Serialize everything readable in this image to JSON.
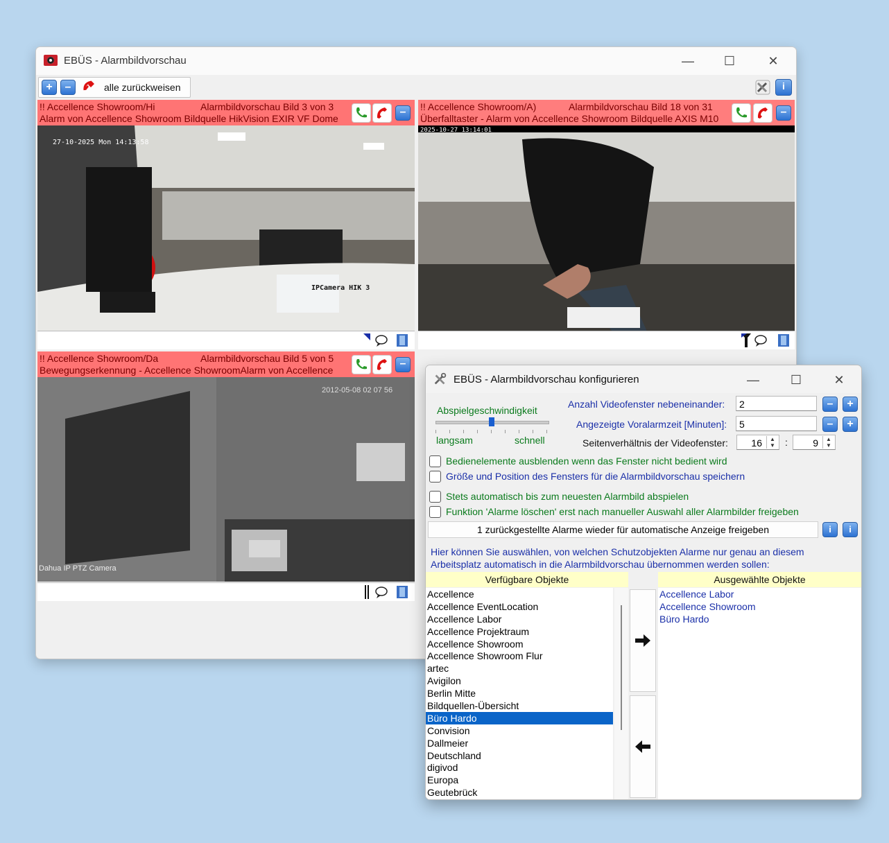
{
  "main_window": {
    "title": "EBÜS - Alarmbildvorschau",
    "toolbar": {
      "reject_all_label": "alle zurückweisen"
    },
    "panes": [
      {
        "line1_left": "!! Accellence Showroom/Hi",
        "line1_right": "Alarmbildvorschau Bild 3 von 3",
        "line2": "Alarm von Accellence Showroom Bildquelle HikVision EXIR VF Dome",
        "overlay_time": "27-10-2025 Mon 14:13:58",
        "overlay_cam": "IPCamera HIK 3"
      },
      {
        "line1_left": "!! Accellence Showroom/A)",
        "line1_right": "Alarmbildvorschau Bild 18 von 31",
        "line2": "Überfalltaster - Alarm von Accellence Showroom Bildquelle AXIS M10",
        "overlay_time": "2025-10-27  13:14:01"
      },
      {
        "line1_left": "!! Accellence Showroom/Da",
        "line1_right": "Alarmbildvorschau Bild 5 von 5",
        "line2": "Bewegungserkennung - Accellence ShowroomAlarm von Accellence",
        "overlay_time": "2012-05-08 02 07 56",
        "overlay_cam": "Dahua IP PTZ Camera"
      }
    ]
  },
  "config_dialog": {
    "title": "EBÜS - Alarmbildvorschau konfigurieren",
    "speed": {
      "label": "Abspielgeschwindigkeit",
      "slow": "langsam",
      "fast": "schnell",
      "value_fraction": 0.5
    },
    "fields": {
      "windows_side_by_side": {
        "label": "Anzahl Videofenster nebeneinander:",
        "value": "2"
      },
      "pre_alarm_time": {
        "label": "Angezeigte Voralarmzeit [Minuten]:",
        "value": "5"
      },
      "aspect_ratio": {
        "label": "Seitenverhältnis der Videofenster:",
        "w": "16",
        "sep": ":",
        "h": "9"
      }
    },
    "checkboxes": [
      {
        "label": "Bedienelemente ausblenden wenn das Fenster nicht bedient wird",
        "checked": false
      },
      {
        "label": "Größe und Position des Fensters für die Alarmbildvorschau speichern",
        "checked": false
      },
      {
        "label": "Stets automatisch bis zum neuesten Alarmbild abspielen",
        "checked": false
      },
      {
        "label": "Funktion 'Alarme löschen' erst nach manueller Auswahl aller Alarmbilder freigeben",
        "checked": false
      }
    ],
    "release_button": "1 zurückgestellte Alarme wieder für automatische Anzeige freigeben",
    "info_line1": "Hier können Sie auswählen, von welchen Schutzobjekten Alarme nur genau an diesem",
    "info_line2": "Arbeitsplatz automatisch in die Alarmbildvorschau übernommen werden sollen:",
    "available_header": "Verfügbare Objekte",
    "selected_header": "Ausgewählte Objekte",
    "available": [
      "Accellence",
      "Accellence EventLocation",
      "Accellence Labor",
      "Accellence Projektraum",
      "Accellence Showroom",
      "Accellence Showroom Flur",
      "artec",
      "Avigilon",
      "Berlin Mitte",
      "Bildquellen-Übersicht",
      "Büro Hardo",
      "Convision",
      "Dallmeier",
      "Deutschland",
      "digivod",
      "Europa",
      "Geutebrück"
    ],
    "available_selected_index": 10,
    "selected": [
      "Accellence Labor",
      "Accellence Showroom",
      "Büro Hardo"
    ]
  },
  "colors": {
    "alarm_header": "#ff7474",
    "selection": "#0a64c8",
    "link_blue": "#1a2fa8",
    "green_text": "#0a7a1c",
    "desktop": "#b9d6ee"
  }
}
